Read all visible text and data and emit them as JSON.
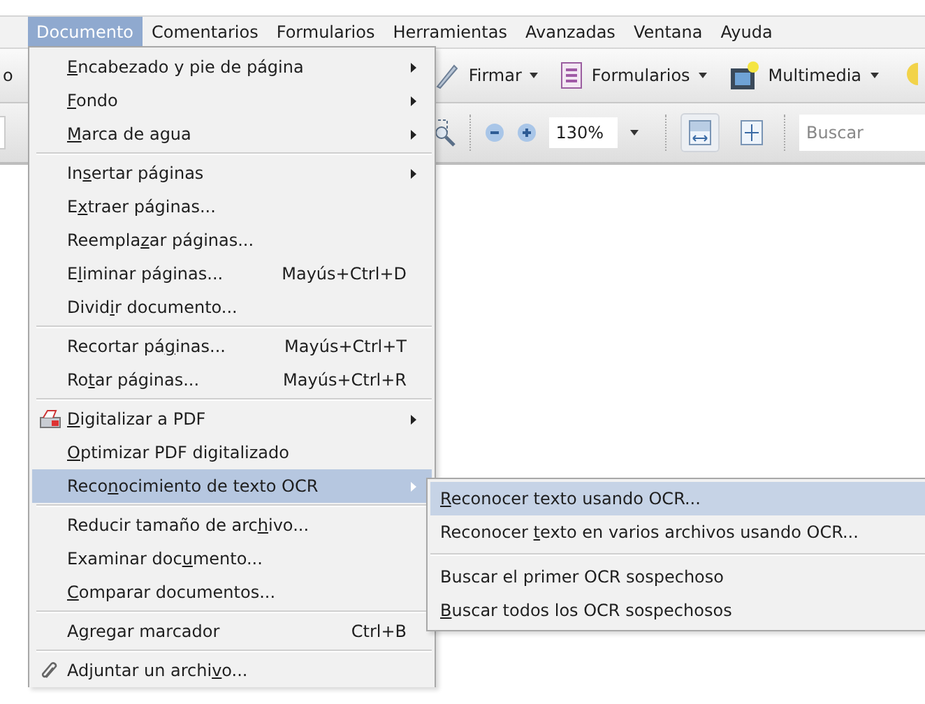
{
  "menubar": [
    {
      "label": "Documento",
      "selected": true
    },
    {
      "label": "Comentarios",
      "selected": false
    },
    {
      "label": "Formularios",
      "selected": false
    },
    {
      "label": "Herramientas",
      "selected": false
    },
    {
      "label": "Avanzadas",
      "selected": false
    },
    {
      "label": "Ventana",
      "selected": false
    },
    {
      "label": "Ayuda",
      "selected": false
    }
  ],
  "toolbar": {
    "left_text": "o",
    "tools": [
      {
        "kind": "sign",
        "label": "Firmar"
      },
      {
        "kind": "forms",
        "label": "Formularios"
      },
      {
        "kind": "media",
        "label": "Multimedia"
      }
    ],
    "zoom": "130%",
    "view_buttons": [
      {
        "kind": "fitwidth",
        "selected": true
      },
      {
        "kind": "fitpage",
        "selected": false
      }
    ],
    "search": {
      "placeholder": "Buscar"
    }
  },
  "menu": [
    {
      "kind": "item",
      "key": "E",
      "after": "ncabezado y pie de página",
      "submenu": true,
      "selected": false
    },
    {
      "kind": "item",
      "key": "F",
      "after": "ondo",
      "submenu": true,
      "selected": false
    },
    {
      "kind": "item",
      "key": "M",
      "after": "arca de agua",
      "submenu": true,
      "selected": false
    },
    {
      "kind": "separator"
    },
    {
      "kind": "item",
      "before": "In",
      "key": "s",
      "after": "ertar páginas",
      "submenu": true,
      "selected": false
    },
    {
      "kind": "item",
      "before": "E",
      "key": "x",
      "after": "traer páginas...",
      "submenu": false,
      "selected": false
    },
    {
      "kind": "item",
      "before": "Reempla",
      "key": "z",
      "after": "ar páginas...",
      "submenu": false,
      "selected": false
    },
    {
      "kind": "item",
      "before": "E",
      "key": "l",
      "after": "iminar páginas...",
      "shortcut": "Mayús+Ctrl+D",
      "submenu": false,
      "selected": false
    },
    {
      "kind": "item",
      "before": "Divid",
      "key": "i",
      "after": "r documento...",
      "submenu": false,
      "selected": false
    },
    {
      "kind": "separator"
    },
    {
      "kind": "item",
      "before": "Recortar pá",
      "key": "g",
      "after": "inas...",
      "shortcut": "Mayús+Ctrl+T",
      "submenu": false,
      "selected": false
    },
    {
      "kind": "item",
      "before": "Ro",
      "key": "t",
      "after": "ar páginas...",
      "shortcut": "Mayús+Ctrl+R",
      "submenu": false,
      "selected": false
    },
    {
      "kind": "separator"
    },
    {
      "kind": "scan",
      "key": "D",
      "after": "igitalizar a PDF",
      "submenu": true,
      "selected": false
    },
    {
      "kind": "item",
      "key": "O",
      "after": "ptimizar PDF digitalizado",
      "submenu": false,
      "selected": false
    },
    {
      "kind": "item",
      "before": "Reco",
      "key": "n",
      "after": "ocimiento de texto OCR",
      "submenu": true,
      "selected": true
    },
    {
      "kind": "separator"
    },
    {
      "kind": "item",
      "before": "Reducir tamaño de arc",
      "key": "h",
      "after": "ivo...",
      "submenu": false,
      "selected": false
    },
    {
      "kind": "item",
      "before": "Examinar doc",
      "key": "u",
      "after": "mento...",
      "submenu": false,
      "selected": false
    },
    {
      "kind": "item",
      "key": "C",
      "after": "omparar documentos...",
      "submenu": false,
      "selected": false
    },
    {
      "kind": "separator"
    },
    {
      "kind": "item",
      "before": "A",
      "key": "g",
      "after": "regar marcador",
      "shortcut": "Ctrl+B",
      "submenu": false,
      "selected": false
    },
    {
      "kind": "separator"
    },
    {
      "kind": "attach",
      "before": "Adjuntar un archi",
      "key": "v",
      "after": "o...",
      "submenu": false,
      "selected": false
    }
  ],
  "submenu": [
    {
      "kind": "item",
      "key": "R",
      "after": "econocer texto usando OCR...",
      "selected": true
    },
    {
      "kind": "item",
      "before": "Reconocer ",
      "key": "t",
      "after": "exto en varios archivos usando OCR...",
      "selected": false
    },
    {
      "kind": "separator"
    },
    {
      "kind": "item",
      "before": "Buscar el primer OCR sospechoso",
      "selected": false
    },
    {
      "kind": "item",
      "key": "B",
      "after": "uscar todos los OCR sospechosos",
      "selected": false
    }
  ]
}
